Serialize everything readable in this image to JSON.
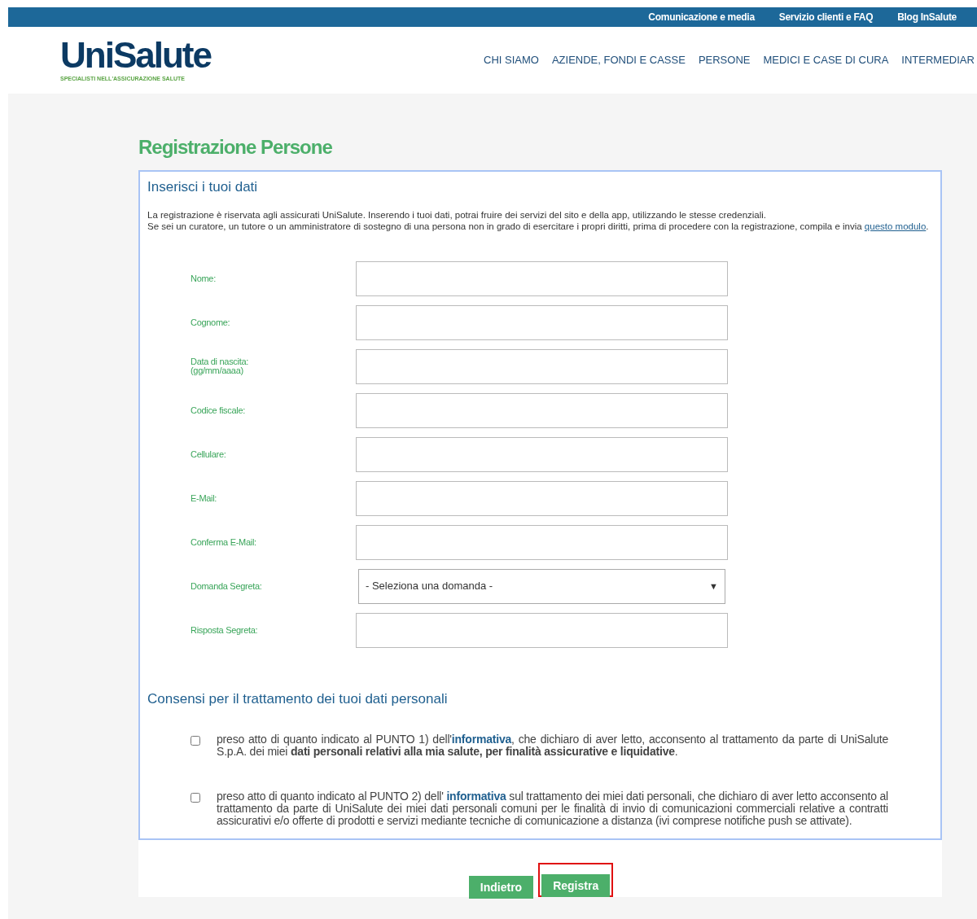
{
  "top_links": [
    "Comunicazione e media",
    "Servizio clienti e FAQ",
    "Blog InSalute"
  ],
  "logo": {
    "name": "UniSalute",
    "tagline": "SPECIALISTI NELL'ASSICURAZIONE SALUTE"
  },
  "nav": [
    "CHI SIAMO",
    "AZIENDE, FONDI E CASSE",
    "PERSONE",
    "MEDICI E CASE DI CURA",
    "INTERMEDIAR"
  ],
  "title": "Registrazione Persone",
  "section_title": "Inserisci i tuoi dati",
  "intro": [
    [
      {
        "kind": "plain",
        "text": "La registrazione è riservata agli assicurati UniSalute. Inserendo i tuoi dati, potrai fruire dei servizi del sito e della app, utilizzando le stesse credenziali."
      }
    ],
    [
      {
        "kind": "plain",
        "text": "Se sei un curatore, un tutore o un amministratore di sostegno di una persona non in grado di esercitare i propri diritti, prima di procedere con la registrazione, compila e invia "
      },
      {
        "kind": "link",
        "text": "questo modulo"
      },
      {
        "kind": "plain",
        "text": "."
      }
    ]
  ],
  "fields": [
    {
      "kind": "text",
      "label": "Nome:"
    },
    {
      "kind": "text",
      "label": "Cognome:"
    },
    {
      "kind": "text",
      "label": "Data di nascita:",
      "hint": "(gg/mm/aaaa)"
    },
    {
      "kind": "text",
      "label": "Codice fiscale:"
    },
    {
      "kind": "text",
      "label": "Cellulare:"
    },
    {
      "kind": "text",
      "label": "E-Mail:"
    },
    {
      "kind": "text",
      "label": "Conferma E-Mail:"
    },
    {
      "kind": "select",
      "label": "Domanda Segreta:",
      "value": "- Seleziona una domanda -",
      "arrow": "▼"
    },
    {
      "kind": "text",
      "label": "Risposta Segreta:"
    }
  ],
  "consent_title": "Consensi per il trattamento dei tuoi dati personali",
  "consents": [
    {
      "checked": false,
      "parts": [
        {
          "kind": "plain",
          "text": "preso atto di quanto indicato al PUNTO 1) dell'"
        },
        {
          "kind": "link",
          "text": "informativa"
        },
        {
          "kind": "plain",
          "text": ", che dichiaro di aver letto, acconsento al trattamento da parte di UniSalute S.p.A. dei miei "
        },
        {
          "kind": "bold",
          "text": "dati personali relativi alla mia salute, per finalità assicurative e liquidative"
        },
        {
          "kind": "plain",
          "text": "."
        }
      ]
    },
    {
      "checked": false,
      "parts": [
        {
          "kind": "plain",
          "text": "preso atto di quanto indicato al PUNTO 2) dell' "
        },
        {
          "kind": "link",
          "text": "informativa"
        },
        {
          "kind": "plain",
          "text": " sul trattamento dei miei dati personali, che dichiaro di aver letto acconsento al trattamento da parte di UniSalute dei miei dati personali comuni per le finalità di invio di comunicazioni commerciali relative a contratti assicurativi e/o offerte di prodotti e servizi mediante tecniche di comunicazione a distanza (ivi comprese notifiche push se attivate)."
        }
      ]
    }
  ],
  "buttons": [
    {
      "label": "Indietro",
      "highlighted": false
    },
    {
      "label": "Registra",
      "highlighted": true
    }
  ]
}
